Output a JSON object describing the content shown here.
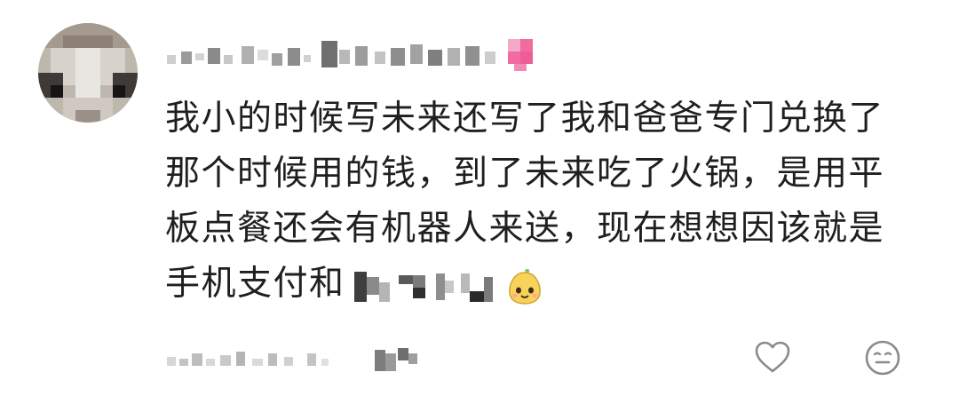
{
  "comment": {
    "text_lines": [
      "我小的时候写未来还写了我和爸爸专门兑换了",
      "那个时候用的钱，到了未来吃了火锅，是用平",
      "板点餐还会有机器人来送，现在想想因该就是",
      "手机支付和"
    ],
    "username_redacted": true,
    "redacted_tail": true,
    "emoji": "smiling-pear-sticker"
  },
  "actions": {
    "like_icon": "heart-outline-icon",
    "reaction_icon": "emoji-face-icon"
  },
  "colors": {
    "text": "#1f1f1f",
    "icon": "#8a8a8a",
    "pixel_dark": "#4a4a4a",
    "pixel_light": "#d9d9d9",
    "pink_badge": "#f26aa0",
    "sticker_yellow": "#f7d35a"
  }
}
